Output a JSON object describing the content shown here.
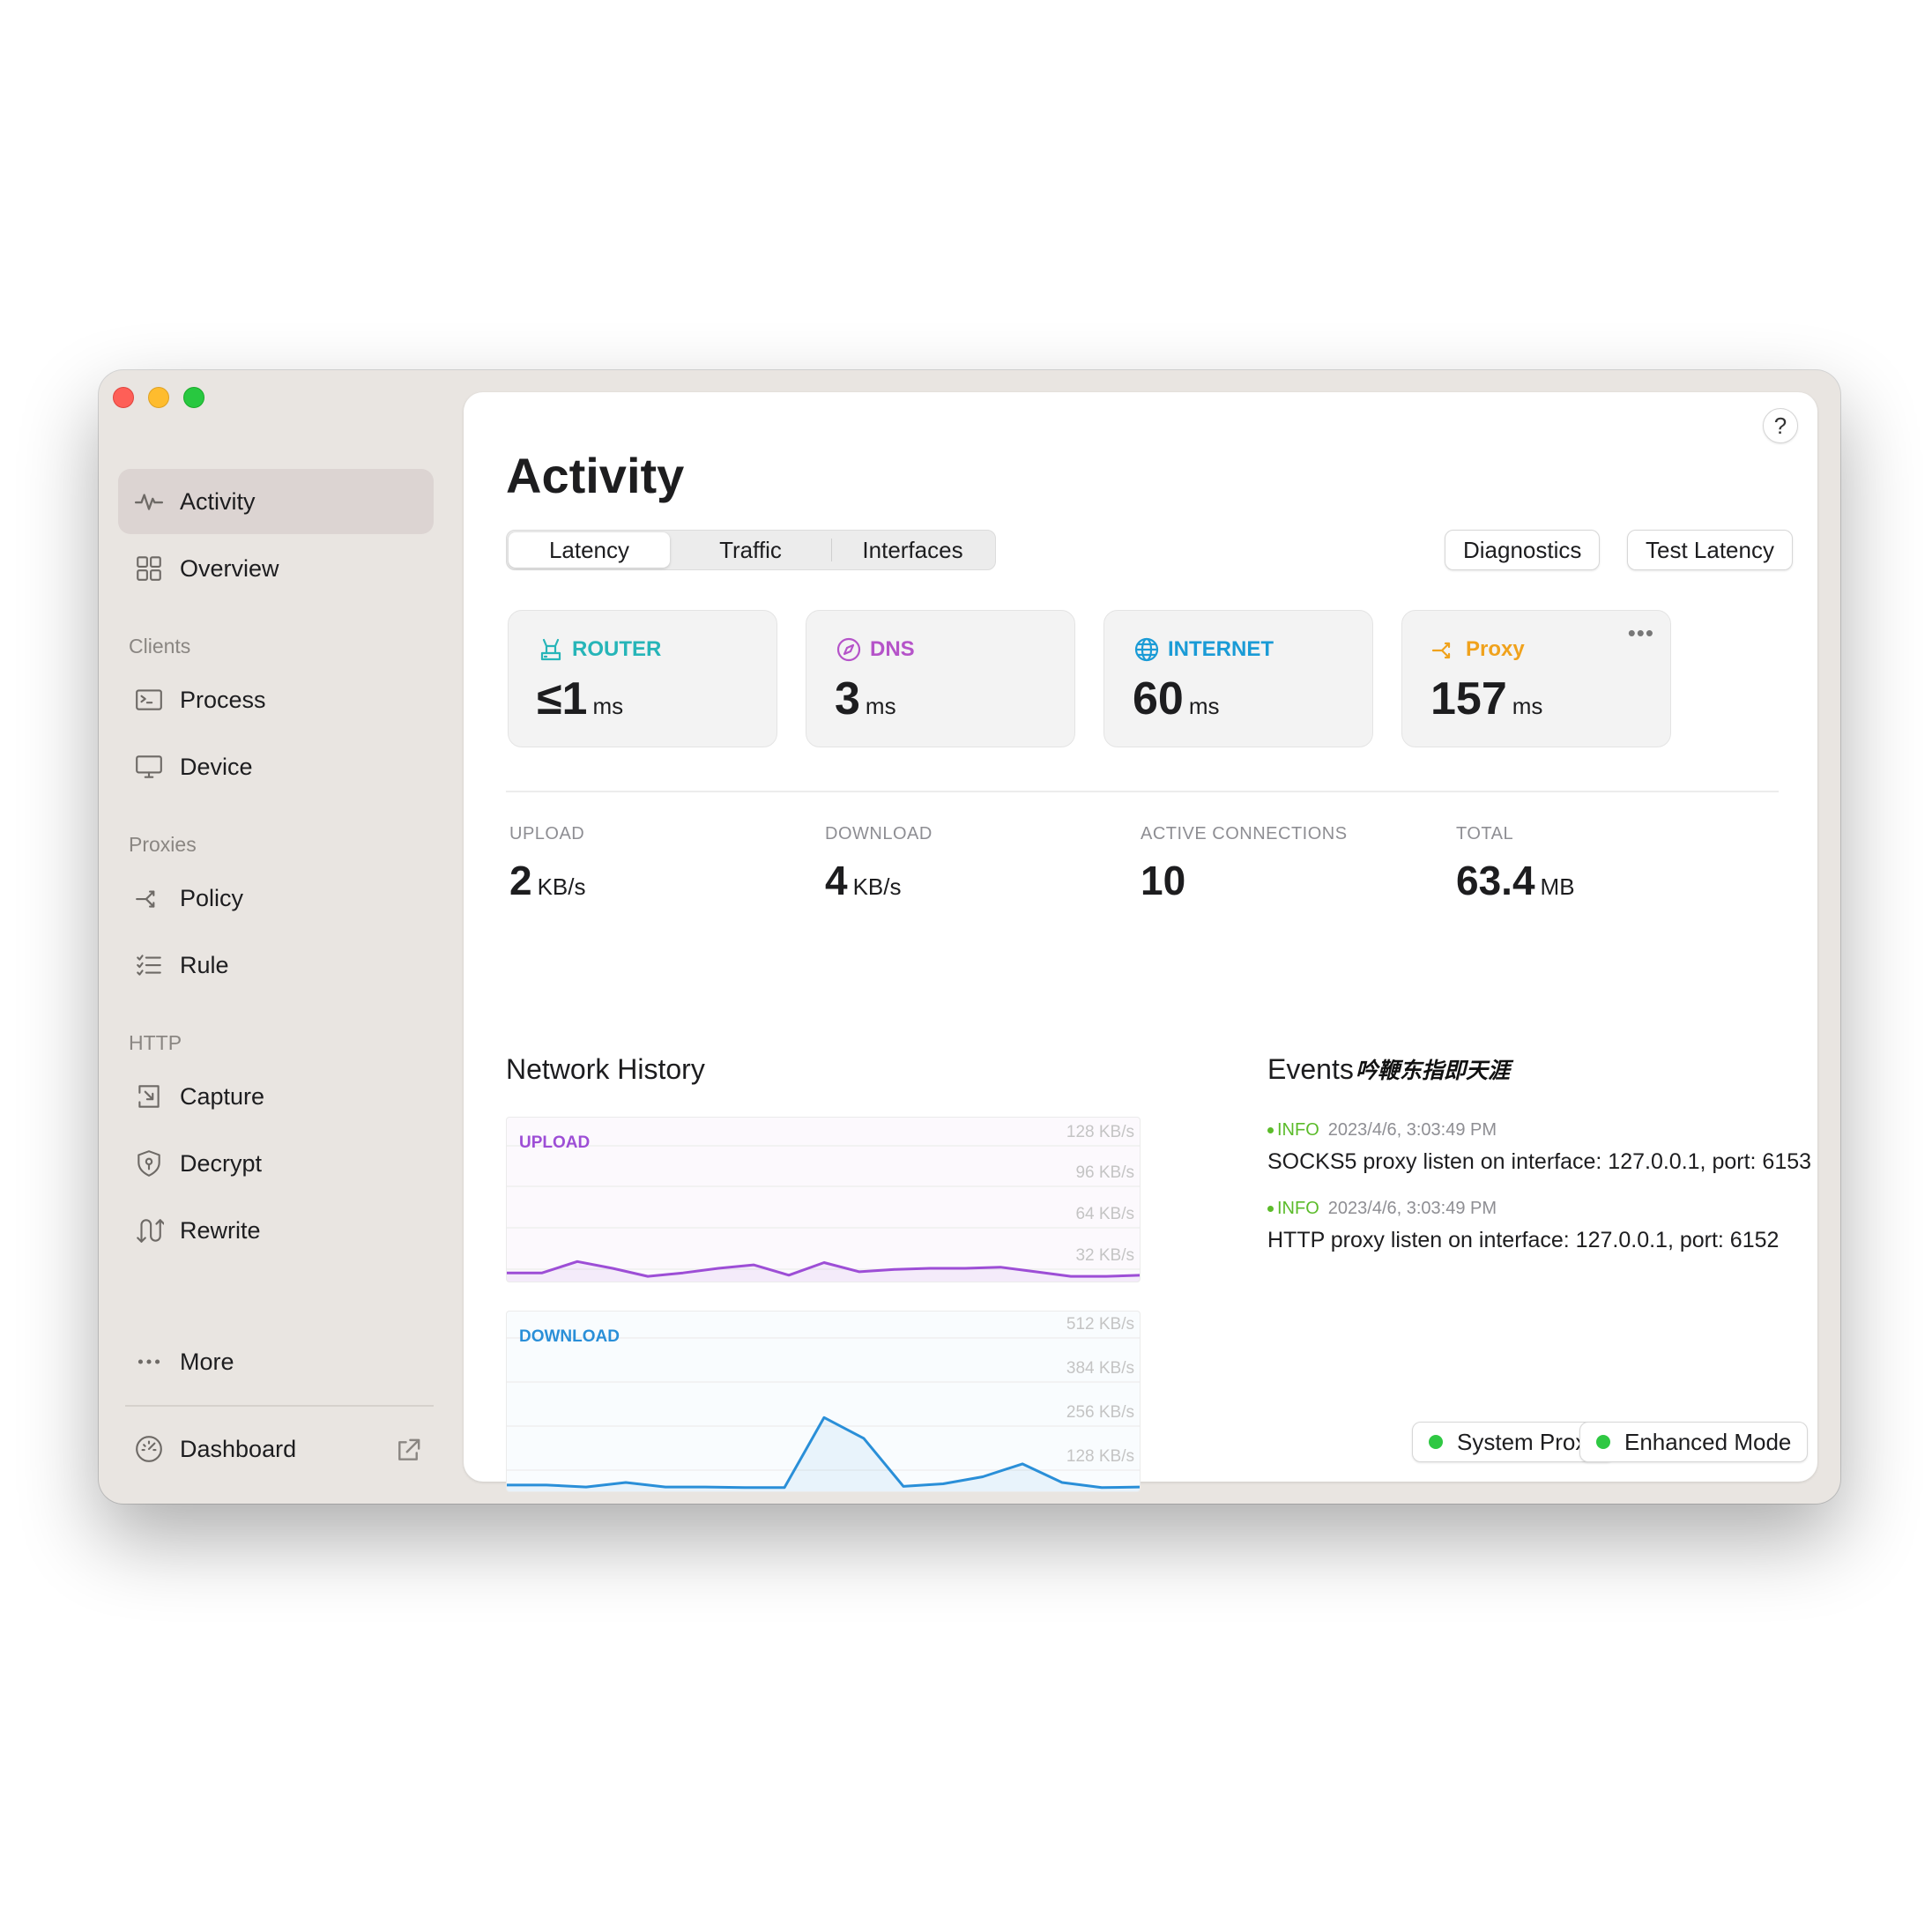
{
  "sidebar": {
    "items": {
      "activity": "Activity",
      "overview": "Overview",
      "process": "Process",
      "device": "Device",
      "policy": "Policy",
      "rule": "Rule",
      "capture": "Capture",
      "decrypt": "Decrypt",
      "rewrite": "Rewrite",
      "more": "More",
      "dashboard": "Dashboard"
    },
    "sections": {
      "clients": "Clients",
      "proxies": "Proxies",
      "http": "HTTP"
    }
  },
  "header": {
    "title": "Activity",
    "help": "?"
  },
  "tabs": [
    "Latency",
    "Traffic",
    "Interfaces"
  ],
  "actions": {
    "diagnostics": "Diagnostics",
    "test_latency": "Test Latency"
  },
  "latency": {
    "router": {
      "label": "ROUTER",
      "value": "≤1",
      "unit": "ms",
      "color": "#26b5b8"
    },
    "dns": {
      "label": "DNS",
      "value": "3",
      "unit": "ms",
      "color": "#b553c9"
    },
    "internet": {
      "label": "INTERNET",
      "value": "60",
      "unit": "ms",
      "color": "#1a9bd6"
    },
    "proxy": {
      "label": "Proxy",
      "value": "157",
      "unit": "ms",
      "color": "#f0a21c"
    }
  },
  "stats": {
    "upload": {
      "label": "UPLOAD",
      "value": "2",
      "unit": "KB/s"
    },
    "download": {
      "label": "DOWNLOAD",
      "value": "4",
      "unit": "KB/s"
    },
    "connections": {
      "label": "ACTIVE CONNECTIONS",
      "value": "10"
    },
    "total": {
      "label": "TOTAL",
      "value": "63.4",
      "unit": "MB"
    }
  },
  "network_history": {
    "title": "Network History",
    "watermark": "吟鞭东指即天涯",
    "upload": {
      "label": "UPLOAD",
      "color": "#9d4ed6",
      "ticks": [
        "128 KB/s",
        "96 KB/s",
        "64 KB/s",
        "32 KB/s"
      ],
      "max": 128,
      "values": [
        6,
        6,
        16,
        10,
        3,
        6,
        10,
        13,
        4,
        15,
        7,
        9,
        10,
        10,
        11,
        7,
        3,
        3,
        4
      ]
    },
    "download": {
      "label": "DOWNLOAD",
      "color": "#2a8fd8",
      "ticks": [
        "512 KB/s",
        "384 KB/s",
        "256 KB/s",
        "128 KB/s"
      ],
      "max": 512,
      "values": [
        14,
        14,
        8,
        22,
        8,
        8,
        6,
        6,
        225,
        160,
        10,
        18,
        40,
        80,
        22,
        6,
        8
      ]
    }
  },
  "events": {
    "title": "Events",
    "items": [
      {
        "level": "INFO",
        "time": "2023/4/6, 3:03:49 PM",
        "message": "SOCKS5 proxy listen on interface: 127.0.0.1, port: 6153"
      },
      {
        "level": "INFO",
        "time": "2023/4/6, 3:03:49 PM",
        "message": "HTTP proxy listen on interface: 127.0.0.1, port: 6152"
      }
    ]
  },
  "status": {
    "system_proxy": "System Proxy",
    "enhanced_mode": "Enhanced Mode",
    "on_color": "#2fc843"
  }
}
